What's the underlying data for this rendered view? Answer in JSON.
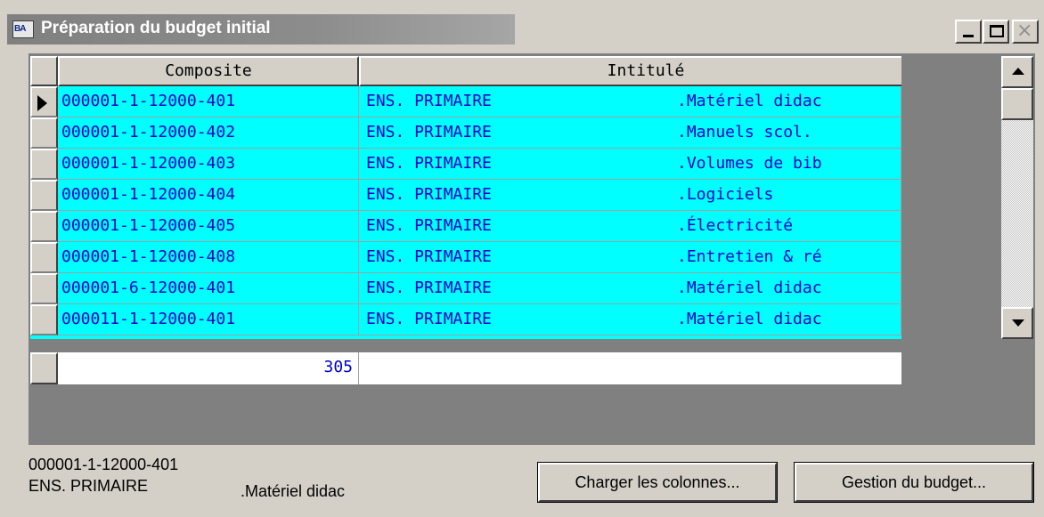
{
  "window": {
    "title": "Préparation du budget initial",
    "icon_label": "BA",
    "close_glyph": "×"
  },
  "grid": {
    "columns": [
      "Composite",
      "Intitulé"
    ],
    "rows": [
      {
        "composite": "000001-1-12000-401",
        "intitule_a": "ENS. PRIMAIRE",
        "intitule_b": ".Matériel didac",
        "selected": true
      },
      {
        "composite": "000001-1-12000-402",
        "intitule_a": "ENS. PRIMAIRE",
        "intitule_b": ".Manuels scol."
      },
      {
        "composite": "000001-1-12000-403",
        "intitule_a": "ENS. PRIMAIRE",
        "intitule_b": ".Volumes de bib"
      },
      {
        "composite": "000001-1-12000-404",
        "intitule_a": "ENS. PRIMAIRE",
        "intitule_b": ".Logiciels"
      },
      {
        "composite": "000001-1-12000-405",
        "intitule_a": "ENS. PRIMAIRE",
        "intitule_b": ".Électricité"
      },
      {
        "composite": "000001-1-12000-408",
        "intitule_a": "ENS. PRIMAIRE",
        "intitule_b": ".Entretien & ré"
      },
      {
        "composite": "000001-6-12000-401",
        "intitule_a": "ENS. PRIMAIRE",
        "intitule_b": ".Matériel didac"
      },
      {
        "composite": "000011-1-12000-401",
        "intitule_a": "ENS. PRIMAIRE",
        "intitule_b": ".Matériel didac"
      }
    ],
    "total": "305"
  },
  "details": {
    "composite": "000001-1-12000-401",
    "group": "ENS. PRIMAIRE",
    "description": ".Matériel didac"
  },
  "buttons": {
    "load_columns": "Charger les colonnes...",
    "manage_budget": "Gestion du budget..."
  },
  "colors": {
    "grid_bg": "#00ffff",
    "text": "#0000cc",
    "face": "#d4d0c8",
    "panel": "#808080"
  }
}
